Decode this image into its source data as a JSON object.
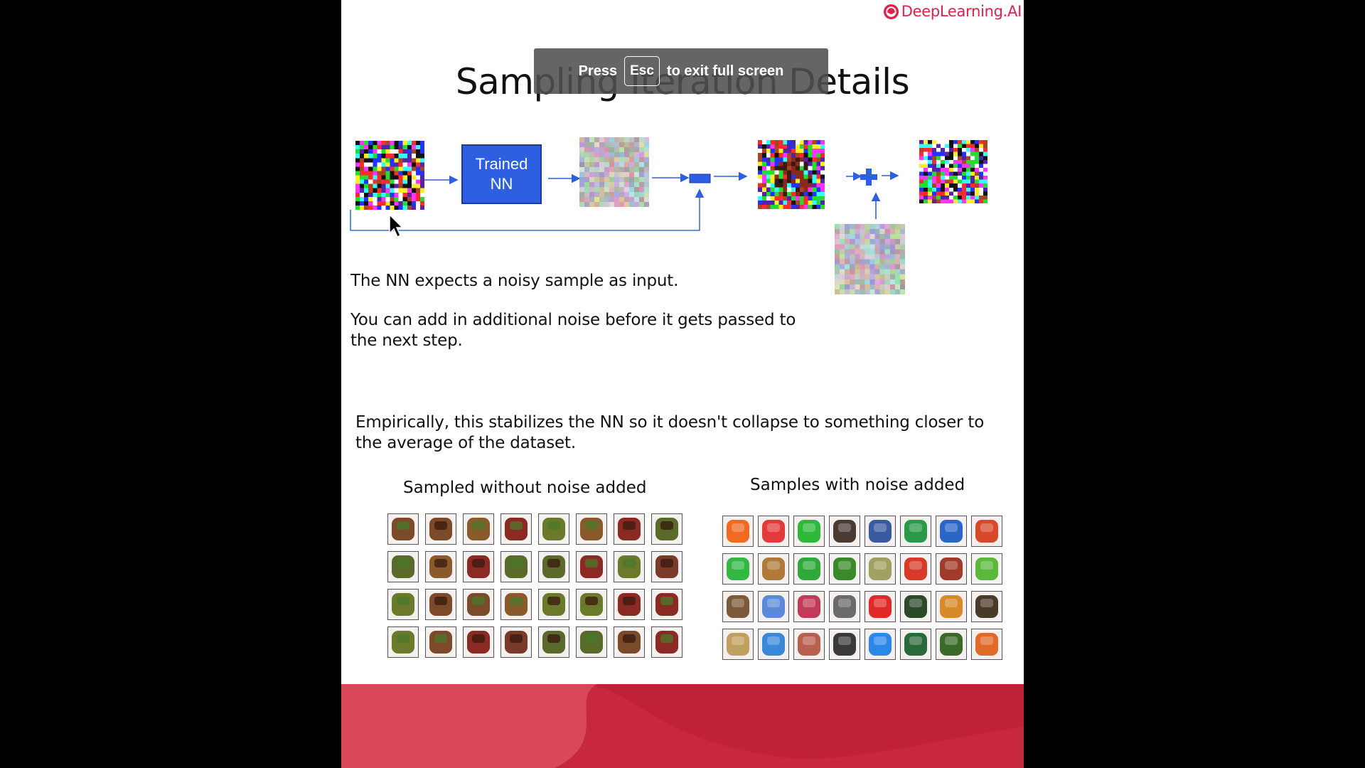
{
  "brand": {
    "name": "DeepLearning.AI",
    "color": "#e0214a"
  },
  "slide": {
    "title": "Sampling Iteration Details",
    "diagram": {
      "nn_label": "Trained NN"
    },
    "text1": "The NN expects a noisy sample as input.",
    "text2": "You can add in additional noise before it gets passed to the next step.",
    "text3": "Empirically, this stabilizes the NN so it doesn't collapse to something closer to the average of the dataset.",
    "left_grid_title": "Sampled without noise added",
    "right_grid_title": "Samples with noise added"
  },
  "fullscreen_toast": {
    "press": "Press",
    "key": "Esc",
    "rest": "to exit full screen"
  },
  "colors": {
    "banner": "#c8283d",
    "nn_box": "#2d5fe0",
    "arrow": "#2d5fe0"
  }
}
